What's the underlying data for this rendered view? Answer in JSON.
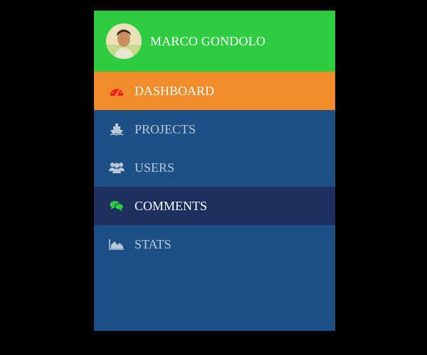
{
  "profile": {
    "name": "MARCO GONDOLO"
  },
  "menu": {
    "items": [
      {
        "label": "DASHBOARD",
        "icon": "dashboard-gauge-icon",
        "icon_color": "#e8231b",
        "state": "active"
      },
      {
        "label": "PROJECTS",
        "icon": "ship-icon",
        "icon_color": "#b9c7d8",
        "state": "normal"
      },
      {
        "label": "USERS",
        "icon": "users-group-icon",
        "icon_color": "#b9c7d8",
        "state": "normal"
      },
      {
        "label": "COMMENTS",
        "icon": "comments-icon",
        "icon_color": "#2ecc40",
        "state": "selected"
      },
      {
        "label": "STATS",
        "icon": "area-chart-icon",
        "icon_color": "#b9c7d8",
        "state": "normal"
      }
    ]
  },
  "colors": {
    "header_bg": "#2ecc40",
    "panel_bg": "#1d5185",
    "dashboard_bg": "#f28c2b",
    "selected_bg": "#1d2f5e",
    "page_bg": "#000000"
  }
}
